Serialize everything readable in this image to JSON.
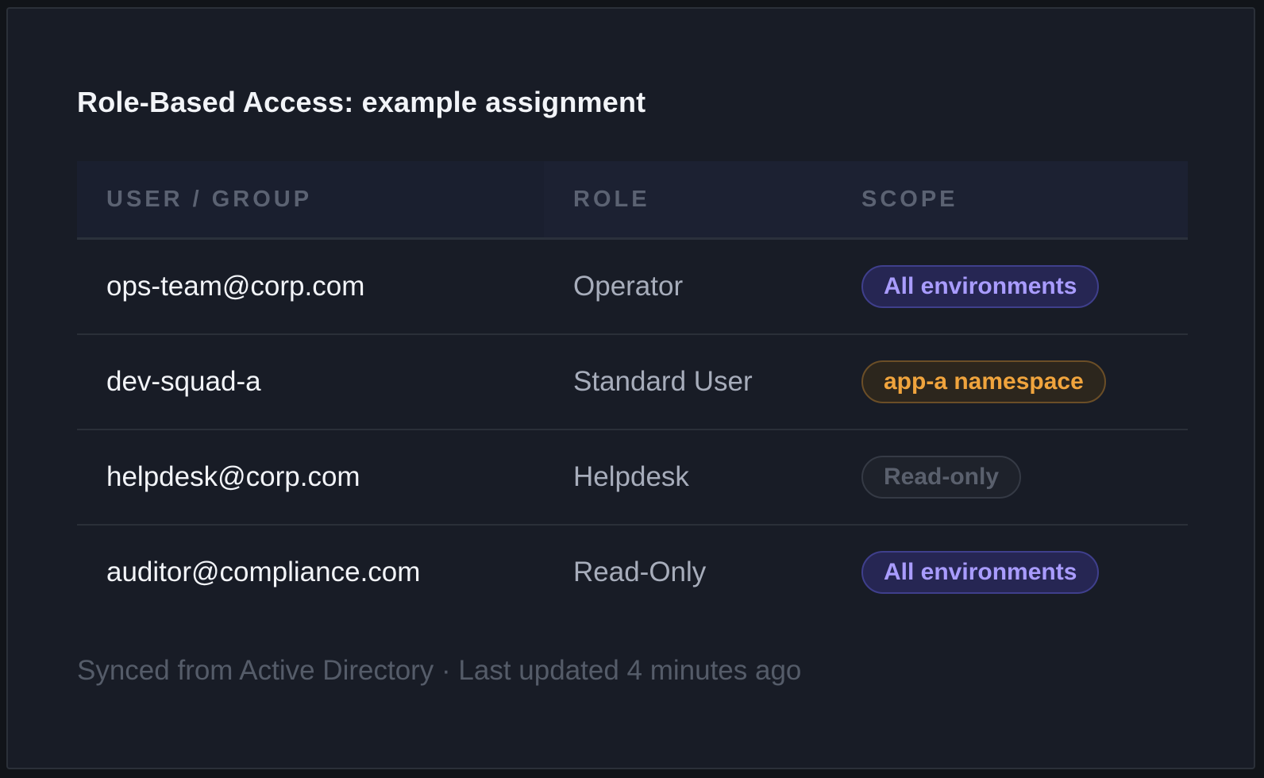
{
  "card": {
    "title": "Role-Based Access: example assignment",
    "footer": "Synced from Active Directory · Last updated 4 minutes ago"
  },
  "table": {
    "columns": [
      "USER / GROUP",
      "ROLE",
      "SCOPE"
    ],
    "rows": [
      {
        "user": "ops-team@corp.com",
        "role": "Operator",
        "scope": "All environments",
        "scope_type": "all"
      },
      {
        "user": "dev-squad-a",
        "role": "Standard User",
        "scope": "app-a namespace",
        "scope_type": "namespace"
      },
      {
        "user": "helpdesk@corp.com",
        "role": "Helpdesk",
        "scope": "Read-only",
        "scope_type": "read-only"
      },
      {
        "user": "auditor@compliance.com",
        "role": "Read-Only",
        "scope": "All environments",
        "scope_type": "all"
      }
    ]
  },
  "colors": {
    "background": "#181c26",
    "scope_all": "#a99cff",
    "scope_namespace": "#f0a43d",
    "scope_read_only": "#5a606d"
  }
}
